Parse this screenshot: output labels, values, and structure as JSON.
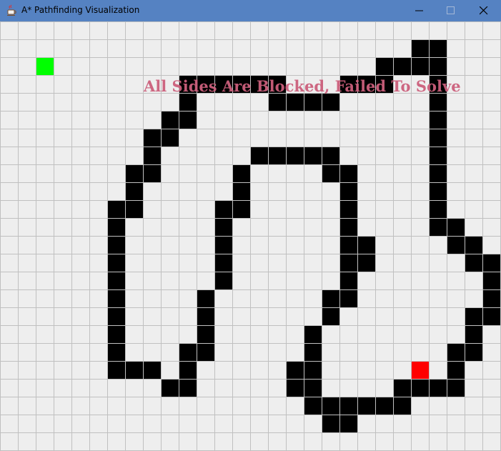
{
  "window": {
    "title": "A* Pathfinding Visualization",
    "controls": [
      "minimize",
      "maximize",
      "close"
    ]
  },
  "grid": {
    "cell_colors": {
      "empty": "#eeeeee",
      "line": "#c0c0c0",
      "wall": "#000000",
      "start": "#00ff00",
      "end": "#ff0000"
    },
    "start_cell": [
      2,
      2
    ],
    "end_cell": [
      23,
      19
    ],
    "walls": [
      [
        23,
        1
      ],
      [
        24,
        1
      ],
      [
        21,
        2
      ],
      [
        22,
        2
      ],
      [
        23,
        2
      ],
      [
        24,
        2
      ],
      [
        10,
        3
      ],
      [
        11,
        3
      ],
      [
        12,
        3
      ],
      [
        13,
        3
      ],
      [
        14,
        3
      ],
      [
        15,
        3
      ],
      [
        19,
        3
      ],
      [
        20,
        3
      ],
      [
        21,
        3
      ],
      [
        24,
        3
      ],
      [
        10,
        4
      ],
      [
        15,
        4
      ],
      [
        16,
        4
      ],
      [
        17,
        4
      ],
      [
        18,
        4
      ],
      [
        24,
        4
      ],
      [
        9,
        5
      ],
      [
        10,
        5
      ],
      [
        24,
        5
      ],
      [
        8,
        6
      ],
      [
        9,
        6
      ],
      [
        24,
        6
      ],
      [
        8,
        7
      ],
      [
        14,
        7
      ],
      [
        15,
        7
      ],
      [
        16,
        7
      ],
      [
        17,
        7
      ],
      [
        18,
        7
      ],
      [
        24,
        7
      ],
      [
        7,
        8
      ],
      [
        8,
        8
      ],
      [
        13,
        8
      ],
      [
        18,
        8
      ],
      [
        19,
        8
      ],
      [
        24,
        8
      ],
      [
        7,
        9
      ],
      [
        13,
        9
      ],
      [
        19,
        9
      ],
      [
        24,
        9
      ],
      [
        6,
        10
      ],
      [
        7,
        10
      ],
      [
        12,
        10
      ],
      [
        13,
        10
      ],
      [
        19,
        10
      ],
      [
        24,
        10
      ],
      [
        6,
        11
      ],
      [
        12,
        11
      ],
      [
        19,
        11
      ],
      [
        24,
        11
      ],
      [
        25,
        11
      ],
      [
        6,
        12
      ],
      [
        12,
        12
      ],
      [
        19,
        12
      ],
      [
        20,
        12
      ],
      [
        25,
        12
      ],
      [
        26,
        12
      ],
      [
        6,
        13
      ],
      [
        12,
        13
      ],
      [
        19,
        13
      ],
      [
        20,
        13
      ],
      [
        26,
        13
      ],
      [
        27,
        13
      ],
      [
        6,
        14
      ],
      [
        12,
        14
      ],
      [
        19,
        14
      ],
      [
        27,
        14
      ],
      [
        6,
        15
      ],
      [
        11,
        15
      ],
      [
        18,
        15
      ],
      [
        19,
        15
      ],
      [
        27,
        15
      ],
      [
        6,
        16
      ],
      [
        11,
        16
      ],
      [
        18,
        16
      ],
      [
        26,
        16
      ],
      [
        27,
        16
      ],
      [
        6,
        17
      ],
      [
        11,
        17
      ],
      [
        17,
        17
      ],
      [
        26,
        17
      ],
      [
        6,
        18
      ],
      [
        10,
        18
      ],
      [
        11,
        18
      ],
      [
        17,
        18
      ],
      [
        25,
        18
      ],
      [
        26,
        18
      ],
      [
        6,
        19
      ],
      [
        7,
        19
      ],
      [
        8,
        19
      ],
      [
        10,
        19
      ],
      [
        16,
        19
      ],
      [
        17,
        19
      ],
      [
        25,
        19
      ],
      [
        9,
        20
      ],
      [
        10,
        20
      ],
      [
        16,
        20
      ],
      [
        17,
        20
      ],
      [
        22,
        20
      ],
      [
        23,
        20
      ],
      [
        24,
        20
      ],
      [
        25,
        20
      ],
      [
        17,
        21
      ],
      [
        18,
        21
      ],
      [
        19,
        21
      ],
      [
        20,
        21
      ],
      [
        21,
        21
      ],
      [
        22,
        21
      ],
      [
        18,
        22
      ],
      [
        19,
        22
      ]
    ]
  },
  "overlay": {
    "text": "All Sides Are Blocked, Failed To Solve"
  }
}
